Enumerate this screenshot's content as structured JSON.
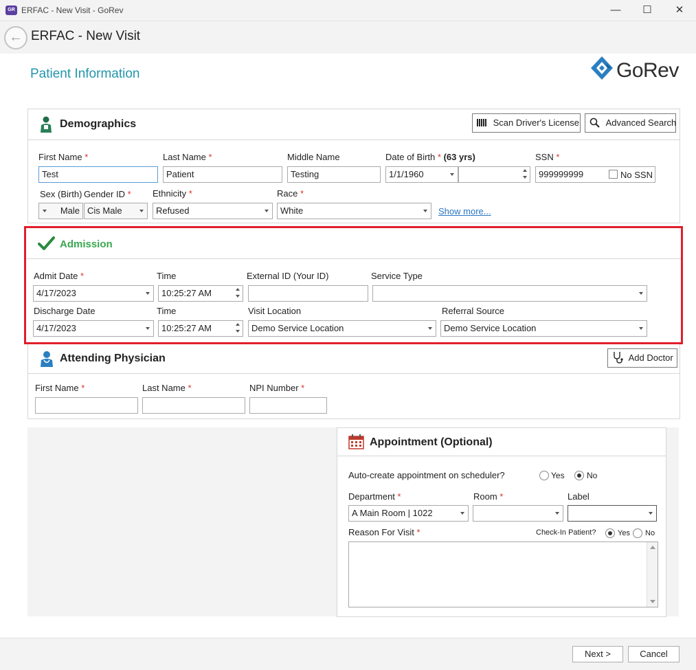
{
  "window": {
    "app_icon": "GR",
    "title": "ERFAC - New Visit - GoRev",
    "minimize": "—",
    "maximize": "☐",
    "close": "✕"
  },
  "header": {
    "back_glyph": "←",
    "title": "ERFAC - New Visit"
  },
  "page": {
    "heading": "Patient Information",
    "logo_text": "GoRev"
  },
  "demographics": {
    "title": "Demographics",
    "scan_button": "Scan Driver's License",
    "search_button": "Advanced Search",
    "labels": {
      "first_name": "First Name",
      "last_name": "Last Name",
      "middle_name": "Middle Name",
      "dob": "Date of Birth",
      "age": "(63 yrs)",
      "ssn": "SSN",
      "sex": "Sex (Birth)",
      "gender": "Gender ID",
      "ethnicity": "Ethnicity",
      "race": "Race"
    },
    "values": {
      "first_name": "Test",
      "last_name": "Patient",
      "middle_name": "Testing",
      "dob": "1/1/1960",
      "ssn": "999999999",
      "sex": "Male",
      "gender": "Cis Male",
      "ethnicity": "Refused",
      "race": "White"
    },
    "no_ssn": "No SSN",
    "show_more": "Show more..."
  },
  "admission": {
    "title": "Admission",
    "labels": {
      "admit_date": "Admit Date",
      "time": "Time",
      "external_id": "External ID (Your ID)",
      "service_type": "Service Type",
      "discharge_date": "Discharge Date",
      "visit_location": "Visit Location",
      "referral_source": "Referral Source"
    },
    "values": {
      "admit_date": "4/17/2023",
      "admit_time": "10:25:27 AM",
      "discharge_date": "4/17/2023",
      "discharge_time": "10:25:27 AM",
      "visit_location": "Demo Service Location",
      "referral_source": "Demo Service Location"
    }
  },
  "physician": {
    "title": "Attending Physician",
    "add_button": "Add Doctor",
    "labels": {
      "first_name": "First Name",
      "last_name": "Last Name",
      "npi": "NPI Number"
    }
  },
  "appointment": {
    "title": "Appointment (Optional)",
    "auto_create": "Auto-create appointment on scheduler?",
    "yes": "Yes",
    "no": "No",
    "labels": {
      "department": "Department",
      "room": "Room",
      "label": "Label",
      "reason": "Reason For Visit",
      "checkin": "Check-In Patient?"
    },
    "values": {
      "department": "A Main Room | 1022"
    }
  },
  "footer": {
    "next_button": "Next >",
    "cancel_button": "Cancel"
  },
  "colors": {
    "accent": "#2296ab",
    "required": "#d9342b",
    "highlight": "#e01e2b",
    "admission_green": "#3aa84f"
  }
}
